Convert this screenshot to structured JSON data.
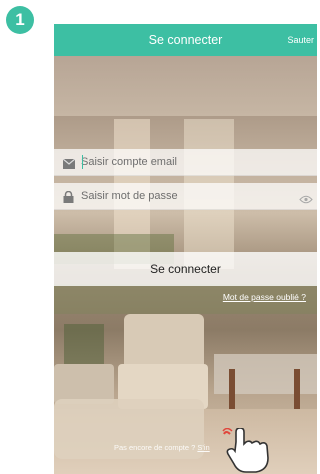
{
  "step": {
    "number": "1"
  },
  "header": {
    "title": "Se connecter",
    "skip_label": "Sauter"
  },
  "form": {
    "email_placeholder": "Saisir compte email",
    "password_placeholder": "Saisir mot de passe",
    "login_label": "Se connecter",
    "forgot_label": "Mot de passe oublié ?"
  },
  "footer": {
    "no_account_text": "Pas encore de compte ?",
    "register_link": "S'in"
  },
  "icons": {
    "email": "mail-icon",
    "password": "lock-icon",
    "show_password": "eye-icon",
    "gesture": "pointing-hand-icon"
  },
  "colors": {
    "accent": "#3dbfa3",
    "text_light": "#ffffff",
    "text_dark": "#222222"
  }
}
